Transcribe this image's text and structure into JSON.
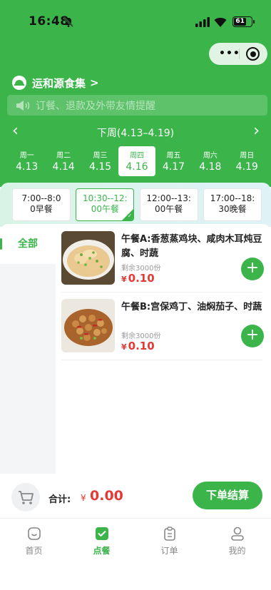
{
  "status_bar": {
    "time": "16:48",
    "battery": "61"
  },
  "store": {
    "name": "运和源食集",
    "arrow": ">"
  },
  "notice": {
    "text": "订餐、退款及外带友情提醒"
  },
  "week": {
    "title": "下周(4.13–4.19)",
    "prev": "‹",
    "next": "›"
  },
  "days": [
    {
      "weekday": "周一",
      "date": "4.13"
    },
    {
      "weekday": "周二",
      "date": "4.14"
    },
    {
      "weekday": "周三",
      "date": "4.15"
    },
    {
      "weekday": "周四",
      "date": "4.16",
      "active": true
    },
    {
      "weekday": "周五",
      "date": "4.17"
    },
    {
      "weekday": "周六",
      "date": "4.18"
    },
    {
      "weekday": "周日",
      "date": "4.19"
    }
  ],
  "meals": [
    {
      "line1": "7:00--8:0",
      "line2": "0早餐"
    },
    {
      "line1": "10:30--12:",
      "line2": "00午餐",
      "active": true
    },
    {
      "line1": "12:00--13:",
      "line2": "00午餐"
    },
    {
      "line1": "17:00--18:",
      "line2": "30晚餐"
    }
  ],
  "categories": [
    {
      "label": "全部",
      "active": true
    }
  ],
  "items": [
    {
      "name": "午餐A:香葱蒸鸡块、咸肉木耳炖豆腐、时蔬",
      "stock": "剩余3000份",
      "currency": "¥",
      "price": "0.10",
      "image": "steamed-chicken-photo"
    },
    {
      "name": "午餐B:宫保鸡丁、油焖茄子、时蔬",
      "stock": "剩余3000份",
      "currency": "¥",
      "price": "0.10",
      "image": "kung-pao-chicken-photo"
    }
  ],
  "cart": {
    "total_label": "合计:",
    "currency": "¥",
    "total": "0.00",
    "checkout_label": "下单结算"
  },
  "tabs": [
    {
      "label": "首页",
      "icon": "home-icon"
    },
    {
      "label": "点餐",
      "icon": "order-food-icon",
      "active": true
    },
    {
      "label": "订单",
      "icon": "clipboard-icon"
    },
    {
      "label": "我的",
      "icon": "profile-icon"
    }
  ],
  "colors": {
    "brand_green": "#3bb54a",
    "price_red": "#e53935"
  }
}
